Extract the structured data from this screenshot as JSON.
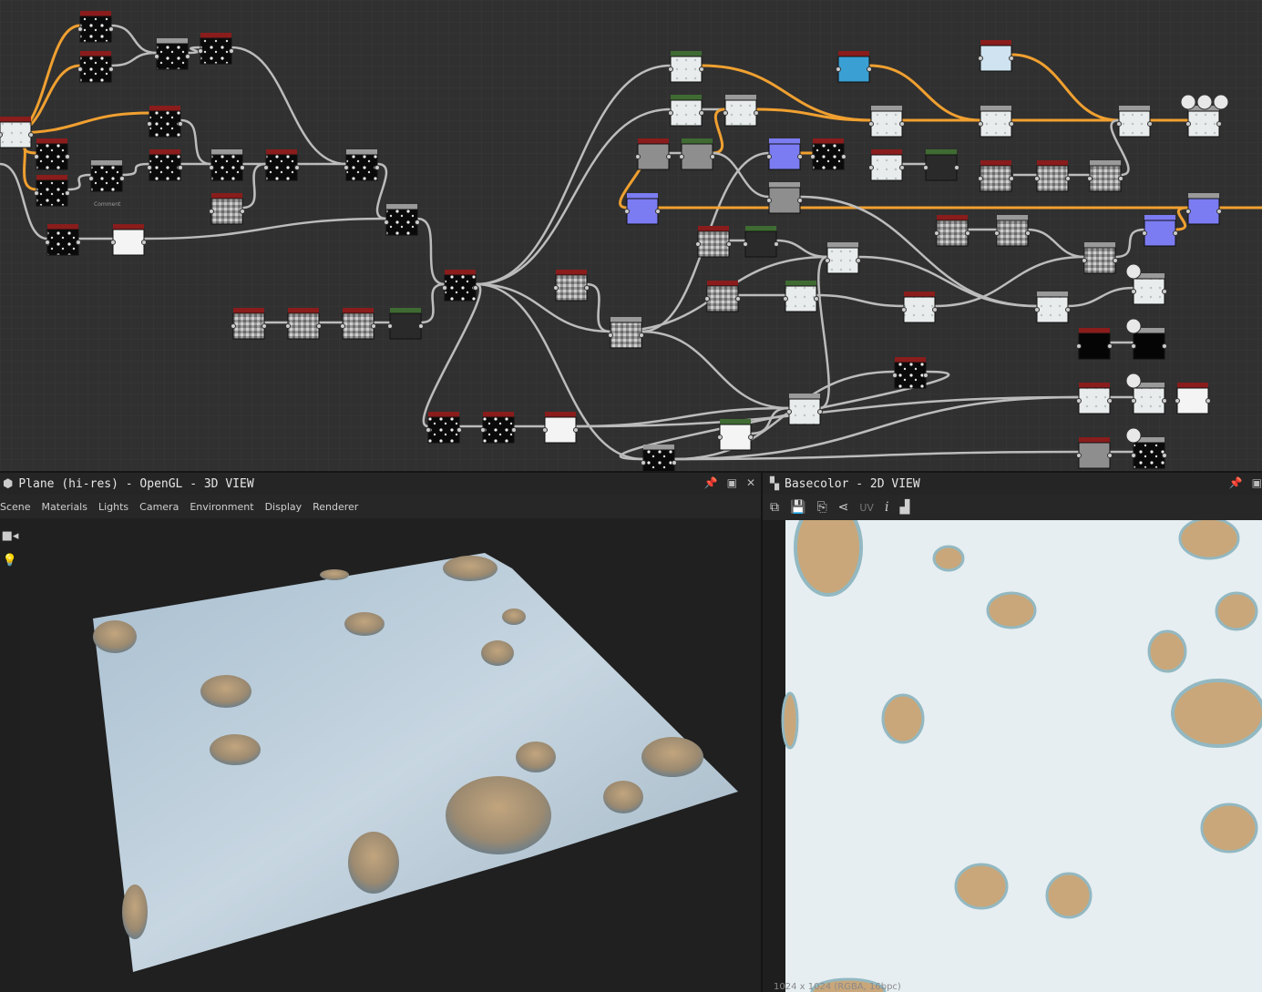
{
  "graph": {
    "comment_label": "Comment"
  },
  "view3d": {
    "title": "Plane (hi-res) - OpenGL - 3D VIEW",
    "menu": [
      "Scene",
      "Materials",
      "Lights",
      "Camera",
      "Environment",
      "Display",
      "Renderer"
    ],
    "icons": [
      "cube-icon",
      "pin-icon",
      "maximize-icon",
      "close-icon",
      "camera-icon",
      "light-bulb-icon"
    ]
  },
  "view2d": {
    "title": "Basecolor - 2D VIEW",
    "toolbar_uv": "UV",
    "info_glyph": "i",
    "status": "1024 x 1024 (RGBA, 16bpc)",
    "icons": [
      "checker-icon",
      "pin-icon",
      "maximize-icon",
      "export-icon",
      "save-icon",
      "copy-icon",
      "share-icon",
      "info-icon",
      "histogram-icon"
    ]
  },
  "colors": {
    "graph_bg": "#303030",
    "node_header_red": "#8a1c1c",
    "node_header_green": "#3f6b32",
    "wire_orange": "#f0a030",
    "wire_gray": "#bcbcbc",
    "snow": "#dfe8ef"
  }
}
